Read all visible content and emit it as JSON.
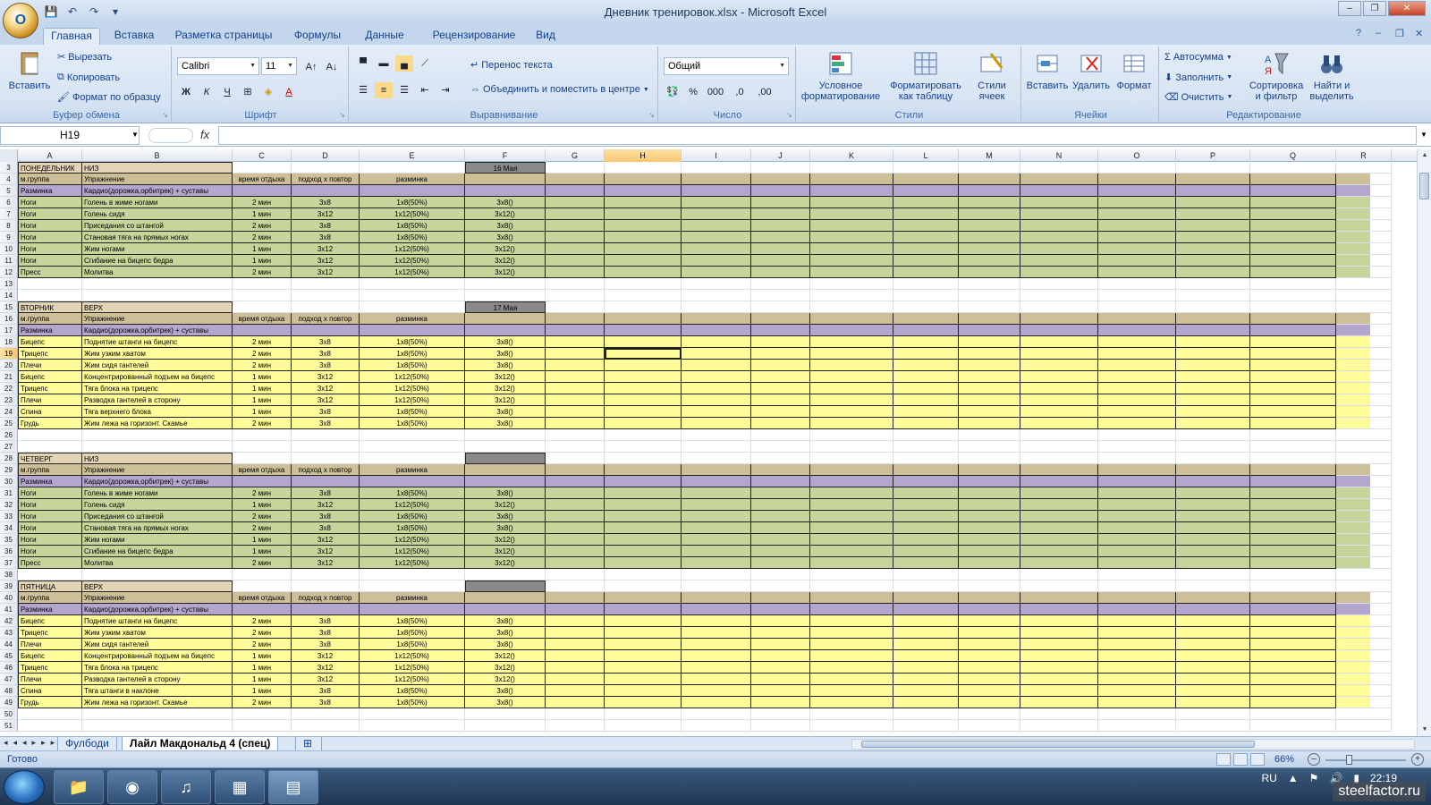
{
  "window": {
    "title": "Дневник тренировок.xlsx - Microsoft Excel",
    "office_button": "O",
    "controls": [
      "–",
      "❐",
      "✕"
    ]
  },
  "tabs": [
    "Главная",
    "Вставка",
    "Разметка страницы",
    "Формулы",
    "Данные",
    "Рецензирование",
    "Вид"
  ],
  "ribbon": {
    "clipboard": {
      "label": "Буфер обмена",
      "paste": "Вставить",
      "cut": "Вырезать",
      "copy": "Копировать",
      "format_painter": "Формат по образцу"
    },
    "font": {
      "label": "Шрифт",
      "name": "Calibri",
      "size": "11",
      "bold": "Ж",
      "italic": "К",
      "underline": "Ч"
    },
    "alignment": {
      "label": "Выравнивание",
      "wrap": "Перенос текста",
      "merge": "Объединить и поместить в центре"
    },
    "number": {
      "label": "Число",
      "format": "Общий",
      "percent": "%",
      "thousands": "000",
      "inc_dec": ",0",
      "dec_dec": ",00"
    },
    "styles": {
      "label": "Стили",
      "conditional": "Условное форматирование",
      "as_table": "Форматировать как таблицу",
      "cell_styles": "Стили ячеек"
    },
    "cells": {
      "label": "Ячейки",
      "insert": "Вставить",
      "delete": "Удалить",
      "format": "Формат"
    },
    "editing": {
      "label": "Редактирование",
      "autosum": "Автосумма",
      "fill": "Заполнить",
      "clear": "Очистить",
      "sort": "Сортировка и фильтр",
      "find": "Найти и выделить"
    }
  },
  "formula_bar": {
    "name_box": "H19",
    "fx": "fx",
    "formula": ""
  },
  "columns": [
    "A",
    "B",
    "C",
    "D",
    "E",
    "F",
    "G",
    "H",
    "I",
    "J",
    "K",
    "L",
    "M",
    "N",
    "O",
    "P",
    "Q",
    "R"
  ],
  "selected_cell": {
    "col": "H",
    "row": "19"
  },
  "rows": [
    {
      "n": "3",
      "k": "t",
      "a": "ПОНЕДЕЛЬНИК",
      "b": "НИЗ",
      "f": "16 Мая"
    },
    {
      "n": "4",
      "k": "h",
      "a": "м.группа",
      "b": "Упражнение",
      "c": "время отдыха",
      "d": "подход х повтор",
      "e": "разминка"
    },
    {
      "n": "5",
      "k": "w",
      "a": "Разминка",
      "b": "Кардио(дорожка,орбитрек) + суставы"
    },
    {
      "n": "6",
      "k": "g",
      "a": "Ноги",
      "b": "Голень в жиме ногами",
      "c": "2 мин",
      "d": "3х8",
      "e": "1х8(50%)",
      "f": "3х8()"
    },
    {
      "n": "7",
      "k": "g",
      "a": "Ноги",
      "b": "Голень сидя",
      "c": "1 мин",
      "d": "3х12",
      "e": "1х12(50%)",
      "f": "3х12()"
    },
    {
      "n": "8",
      "k": "g",
      "a": "Ноги",
      "b": "Приседания со штангой",
      "c": "2 мин",
      "d": "3х8",
      "e": "1х8(50%)",
      "f": "3х8()"
    },
    {
      "n": "9",
      "k": "g",
      "a": "Ноги",
      "b": "Становая тяга на прямых ногах",
      "c": "2 мин",
      "d": "3х8",
      "e": "1х8(50%)",
      "f": "3х8()"
    },
    {
      "n": "10",
      "k": "g",
      "a": "Ноги",
      "b": "Жим ногами",
      "c": "1 мин",
      "d": "3х12",
      "e": "1х12(50%)",
      "f": "3х12()"
    },
    {
      "n": "11",
      "k": "g",
      "a": "Ноги",
      "b": "Сгибание на бицепс бедра",
      "c": "1  мин",
      "d": "3х12",
      "e": "1х12(50%)",
      "f": "3х12()"
    },
    {
      "n": "12",
      "k": "g",
      "a": "Пресс",
      "b": "Молитва",
      "c": "2 мин",
      "d": "3х12",
      "e": "1х12(50%)",
      "f": "3х12()"
    },
    {
      "n": "13",
      "k": "e"
    },
    {
      "n": "14",
      "k": "e"
    },
    {
      "n": "15",
      "k": "t",
      "a": "ВТОРНИК",
      "b": "ВЕРХ",
      "f": "17 Мая"
    },
    {
      "n": "16",
      "k": "h",
      "a": "м.группа",
      "b": "Упражнение",
      "c": "время отдыха",
      "d": "подход х повтор",
      "e": "разминка"
    },
    {
      "n": "17",
      "k": "w",
      "a": "Разминка",
      "b": "Кардио(дорожка,орбитрек) + суставы"
    },
    {
      "n": "18",
      "k": "y",
      "a": "Бицепс",
      "b": "Поднятие штанги на бицепс",
      "c": "2 мин",
      "d": "3х8",
      "e": "1х8(50%)",
      "f": "3х8()"
    },
    {
      "n": "19",
      "k": "y",
      "a": "Трицепс",
      "b": "Жим узким хватом",
      "c": "2 мин",
      "d": "3х8",
      "e": "1х8(50%)",
      "f": "3х8()"
    },
    {
      "n": "20",
      "k": "y",
      "a": "Плечи",
      "b": "Жим сидя гантелей",
      "c": "2 мин",
      "d": "3х8",
      "e": "1х8(50%)",
      "f": "3х8()"
    },
    {
      "n": "21",
      "k": "y",
      "a": "Бицепс",
      "b": "Концентрированный подъем на бицепс",
      "c": "1 мин",
      "d": "3х12",
      "e": "1х12(50%)",
      "f": "3х12()"
    },
    {
      "n": "22",
      "k": "y",
      "a": "Трицепс",
      "b": "Тяга блока на трицепс",
      "c": "1 мин",
      "d": "3х12",
      "e": "1х12(50%)",
      "f": "3х12()"
    },
    {
      "n": "23",
      "k": "y",
      "a": "Плечи",
      "b": "Разводка гантелей в сторону",
      "c": "1 мин",
      "d": "3х12",
      "e": "1х12(50%)",
      "f": "3х12()"
    },
    {
      "n": "24",
      "k": "y",
      "a": "Спина",
      "b": "Тяга верхнего блока",
      "c": "1 мин",
      "d": "3х8",
      "e": "1х8(50%)",
      "f": "3х8()"
    },
    {
      "n": "25",
      "k": "y",
      "a": "Грудь",
      "b": "Жим лежа на горизонт. Скамье",
      "c": "2 мин",
      "d": "3х8",
      "e": "1х8(50%)",
      "f": "3х8()"
    },
    {
      "n": "26",
      "k": "e"
    },
    {
      "n": "27",
      "k": "e"
    },
    {
      "n": "28",
      "k": "t",
      "a": "ЧЕТВЕРГ",
      "b": "НИЗ",
      "f": ""
    },
    {
      "n": "29",
      "k": "h",
      "a": "м.группа",
      "b": "Упражнение",
      "c": "время отдыха",
      "d": "подход х повтор",
      "e": "разминка"
    },
    {
      "n": "30",
      "k": "w",
      "a": "Разминка",
      "b": "Кардио(дорожка,орбитрек) + суставы"
    },
    {
      "n": "31",
      "k": "g",
      "a": "Ноги",
      "b": "Голень в жиме ногами",
      "c": "2 мин",
      "d": "3х8",
      "e": "1х8(50%)",
      "f": "3х8()"
    },
    {
      "n": "32",
      "k": "g",
      "a": "Ноги",
      "b": "Голень сидя",
      "c": "1 мин",
      "d": "3х12",
      "e": "1х12(50%)",
      "f": "3х12()"
    },
    {
      "n": "33",
      "k": "g",
      "a": "Ноги",
      "b": "Приседания со штангой",
      "c": "2 мин",
      "d": "3х8",
      "e": "1х8(50%)",
      "f": "3х8()"
    },
    {
      "n": "34",
      "k": "g",
      "a": "Ноги",
      "b": "Становая тяга на прямых ногах",
      "c": "2 мин",
      "d": "3х8",
      "e": "1х8(50%)",
      "f": "3х8()"
    },
    {
      "n": "35",
      "k": "g",
      "a": "Ноги",
      "b": "Жим ногами",
      "c": "1 мин",
      "d": "3х12",
      "e": "1х12(50%)",
      "f": "3х12()"
    },
    {
      "n": "36",
      "k": "g",
      "a": "Ноги",
      "b": "Сгибание на бицепс бедра",
      "c": "1  мин",
      "d": "3х12",
      "e": "1х12(50%)",
      "f": "3х12()"
    },
    {
      "n": "37",
      "k": "g",
      "a": "Пресс",
      "b": "Молитва",
      "c": "2 мин",
      "d": "3х12",
      "e": "1х12(50%)",
      "f": "3х12()"
    },
    {
      "n": "38",
      "k": "e"
    },
    {
      "n": "39",
      "k": "t",
      "a": "ПЯТНИЦА",
      "b": "ВЕРХ",
      "f": ""
    },
    {
      "n": "40",
      "k": "h",
      "a": "м.группа",
      "b": "Упражнение",
      "c": "время отдыха",
      "d": "подход х повтор",
      "e": "разминка"
    },
    {
      "n": "41",
      "k": "w",
      "a": "Разминка",
      "b": "Кардио(дорожка,орбитрек) + суставы"
    },
    {
      "n": "42",
      "k": "y",
      "a": "Бицепс",
      "b": "Поднятие штанги на бицепс",
      "c": "2 мин",
      "d": "3х8",
      "e": "1х8(50%)",
      "f": "3х8()"
    },
    {
      "n": "43",
      "k": "y",
      "a": "Трицепс",
      "b": "Жим узким хватом",
      "c": "2 мин",
      "d": "3х8",
      "e": "1х8(50%)",
      "f": "3х8()"
    },
    {
      "n": "44",
      "k": "y",
      "a": "Плечи",
      "b": "Жим сидя гантелей",
      "c": "2 мин",
      "d": "3х8",
      "e": "1х8(50%)",
      "f": "3х8()"
    },
    {
      "n": "45",
      "k": "y",
      "a": "Бицепс",
      "b": "Концентрированный подъем на бицепс",
      "c": "1 мин",
      "d": "3х12",
      "e": "1х12(50%)",
      "f": "3х12()"
    },
    {
      "n": "46",
      "k": "y",
      "a": "Трицепс",
      "b": "Тяга блока на трицепс",
      "c": "1 мин",
      "d": "3х12",
      "e": "1х12(50%)",
      "f": "3х12()"
    },
    {
      "n": "47",
      "k": "y",
      "a": "Плечи",
      "b": "Разводка гантелей в сторону",
      "c": "1 мин",
      "d": "3х12",
      "e": "1х12(50%)",
      "f": "3х12()"
    },
    {
      "n": "48",
      "k": "y",
      "a": "Спина",
      "b": "Тяга штанги в наклоне",
      "c": "1 мин",
      "d": "3х8",
      "e": "1х8(50%)",
      "f": "3х8()"
    },
    {
      "n": "49",
      "k": "y",
      "a": "Грудь",
      "b": "Жим лежа на горизонт. Скамье",
      "c": "2 мин",
      "d": "3х8",
      "e": "1х8(50%)",
      "f": "3х8()"
    },
    {
      "n": "50",
      "k": "e"
    },
    {
      "n": "51",
      "k": "e"
    }
  ],
  "colors": {
    "title": "#e2d4b4",
    "header": "#cdbf98",
    "warmup": "#b4a7cf",
    "green": "#c6d59a",
    "yellow": "#fffd9a",
    "date": "#8a8a8a"
  },
  "sheet_tabs": [
    "Фулбоди",
    "Лайл Макдональд 4 (спец)"
  ],
  "status": {
    "ready": "Готово",
    "zoom": "66%"
  },
  "taskbar": {
    "lang": "RU",
    "time": "22:19",
    "watermark": "steelfactor.ru"
  }
}
